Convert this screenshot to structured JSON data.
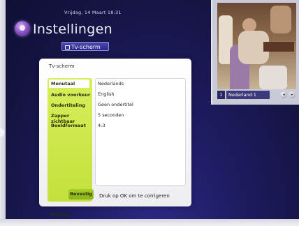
{
  "header": {
    "datetime": "Vrijdag, 14 Maart 18:31",
    "title": "Instellingen",
    "breadcrumb": "Tv-scherm"
  },
  "tv_preview": {
    "channel_number": "1",
    "channel_name": "Nederland 1"
  },
  "panel": {
    "title": "Tv-scherm",
    "menu": [
      {
        "label": "Menutaal",
        "value": "Nederlands",
        "selected": true
      },
      {
        "label": "Audio voorkeur",
        "value": "English"
      },
      {
        "label": "Ondertiteling",
        "value": "Geen ondertitel"
      },
      {
        "label": "Zapper zichtbaar",
        "value": "5 seconden"
      },
      {
        "label": "Beeldformaat",
        "value": "4:3"
      }
    ],
    "back_label": "Terug",
    "confirm_label": "Bevestig",
    "hint": "Druk op OK om te corrigeren"
  },
  "colors": {
    "background": "#1b1b52",
    "menu_green": "#c3e03c",
    "confirm_green": "#8ab21a"
  }
}
